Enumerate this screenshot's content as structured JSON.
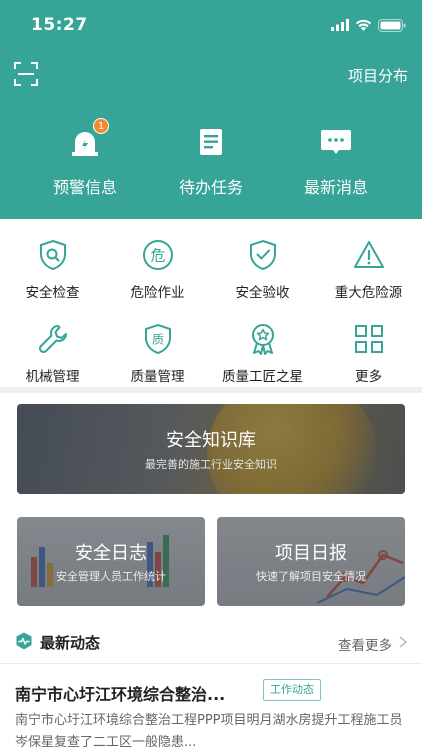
{
  "status_bar": {
    "time": "15:27"
  },
  "header": {
    "right_link": "项目分布",
    "nav": [
      {
        "label": "预警信息",
        "icon": "alarm-icon",
        "badge": "1"
      },
      {
        "label": "待办任务",
        "icon": "task-list-icon"
      },
      {
        "label": "最新消息",
        "icon": "message-icon"
      }
    ]
  },
  "grid": [
    {
      "label": "安全检查",
      "icon": "shield-search-icon"
    },
    {
      "label": "危险作业",
      "icon": "danger-icon",
      "glyph": "危"
    },
    {
      "label": "安全验收",
      "icon": "shield-check-icon"
    },
    {
      "label": "重大危险源",
      "icon": "warning-triangle-icon"
    },
    {
      "label": "机械管理",
      "icon": "wrench-icon"
    },
    {
      "label": "质量管理",
      "icon": "quality-shield-icon",
      "glyph": "质"
    },
    {
      "label": "质量工匠之星",
      "icon": "star-medal-icon"
    },
    {
      "label": "更多",
      "icon": "grid-more-icon"
    }
  ],
  "banner": {
    "title": "安全知识库",
    "subtitle": "最完善的施工行业安全知识"
  },
  "cards": [
    {
      "title": "安全日志",
      "subtitle": "安全管理人员工作统计"
    },
    {
      "title": "项目日报",
      "subtitle": "快速了解项目安全情况"
    }
  ],
  "section": {
    "title": "最新动态",
    "more": "查看更多"
  },
  "news": {
    "title": "南宁市心圩江环境综合整治...",
    "tag": "工作动态",
    "desc": "南宁市心圩江环境综合整治工程PPP项目明月湖水房提升工程施工员岑保星复查了二工区一般隐患..."
  },
  "colors": {
    "accent": "#36a597",
    "badge": "#f28a2c",
    "page_bg": "#ffffff"
  }
}
